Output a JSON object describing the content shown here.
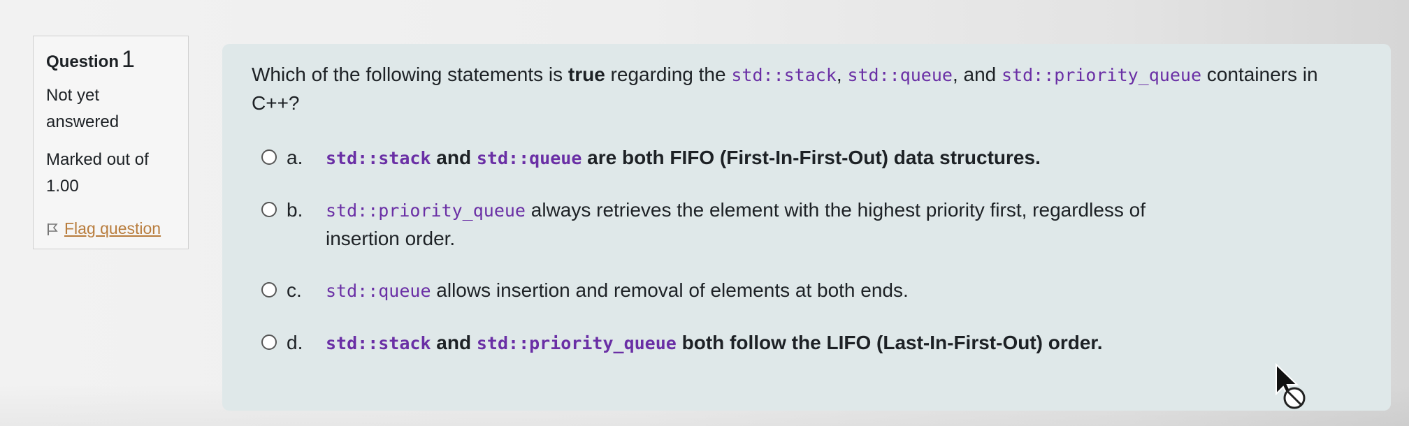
{
  "question_info": {
    "label": "Question",
    "number": "1",
    "state": "Not yet answered",
    "grade": "Marked out of 1.00",
    "flag_label": "Flag question",
    "flag_icon": "flag-icon"
  },
  "question": {
    "text_pre": "Which of the following statements is ",
    "text_bold": "true",
    "text_mid1": " regarding the ",
    "code1": "std::stack",
    "text_mid2": ", ",
    "code2": "std::queue",
    "text_mid3": ", and ",
    "code3": "std::priority_queue",
    "text_post": " containers in C++?"
  },
  "answers": [
    {
      "letter": "a.",
      "code_a": "std::stack",
      "mid": " and ",
      "code_b": "std::queue",
      "rest": " are both FIFO (First-In-First-Out) data structures."
    },
    {
      "letter": "b.",
      "code_a": "std::priority_queue",
      "rest": " always retrieves the element with the highest priority first, regardless of insertion order."
    },
    {
      "letter": "c.",
      "code_a": "std::queue",
      "rest": " allows insertion and removal of elements at both ends."
    },
    {
      "letter": "d.",
      "code_a": "std::stack",
      "mid": " and ",
      "code_b": "std::priority_queue",
      "rest": " both follow the LIFO (Last-In-First-Out) order."
    }
  ],
  "colors": {
    "content_bg": "#dfe8e9",
    "code_color": "#6a2fa5",
    "flag_color": "#b87c3c"
  }
}
